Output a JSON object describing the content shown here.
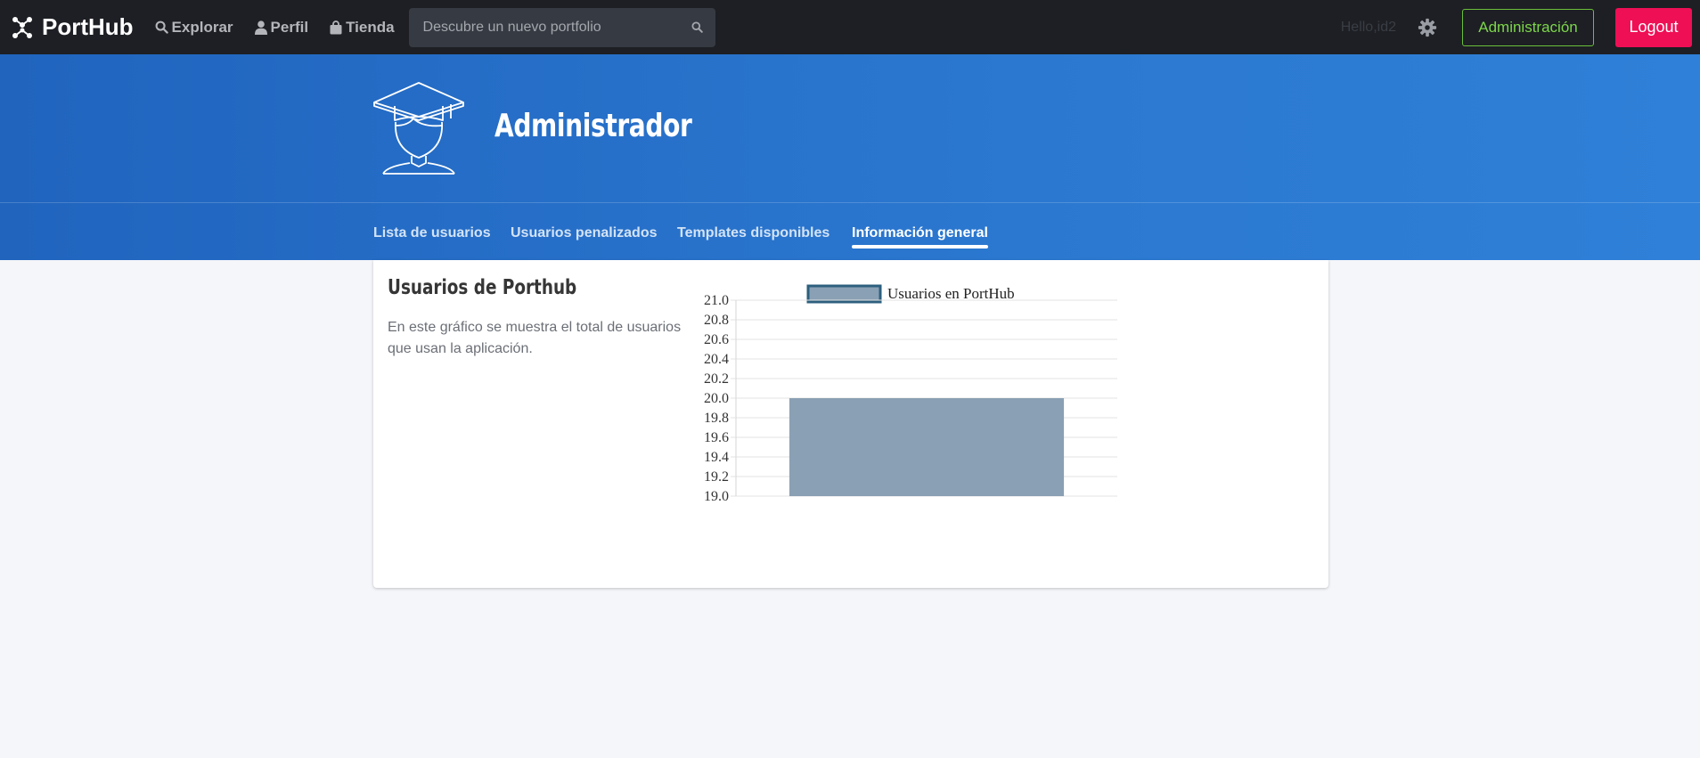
{
  "navbar": {
    "brand": "PortHub",
    "links": [
      {
        "label": "Explorar",
        "icon": "search-icon"
      },
      {
        "label": "Perfil",
        "icon": "user-icon"
      },
      {
        "label": "Tienda",
        "icon": "shopping-bag-icon"
      }
    ],
    "search_placeholder": "Descubre un nuevo portfolio",
    "greeting": "Hello,id2",
    "admin_button": "Administración",
    "logout_button": "Logout"
  },
  "hero": {
    "title": "Administrador",
    "avatar_icon": "graduate-avatar-icon",
    "tabs": [
      {
        "label": "Lista de usuarios",
        "active": false
      },
      {
        "label": "Usuarios penalizados",
        "active": false
      },
      {
        "label": "Templates disponibles",
        "active": false
      },
      {
        "label": "Información general",
        "active": true
      }
    ]
  },
  "card": {
    "title": "Usuarios de Porthub",
    "description": "En este gráfico se muestra el total de usuarios que usan la aplicación."
  },
  "colors": {
    "navbar_bg": "#1d1f24",
    "hero_bg": "#2a74cc",
    "admin_accent": "#7dd64a",
    "logout_bg": "#ef0f55",
    "bar_fill": "#8aa0b4",
    "bar_stroke": "#2d5f7e"
  },
  "chart_data": {
    "type": "bar",
    "categories": [
      ""
    ],
    "series": [
      {
        "name": "Usuarios en PortHub",
        "values": [
          20
        ]
      }
    ],
    "ylim": [
      19.0,
      21.0
    ],
    "yticks": [
      "21.0",
      "20.8",
      "20.6",
      "20.4",
      "20.2",
      "20.0",
      "19.8",
      "19.6",
      "19.4",
      "19.2",
      "19.0"
    ],
    "grid": true,
    "legend": "top-center"
  }
}
